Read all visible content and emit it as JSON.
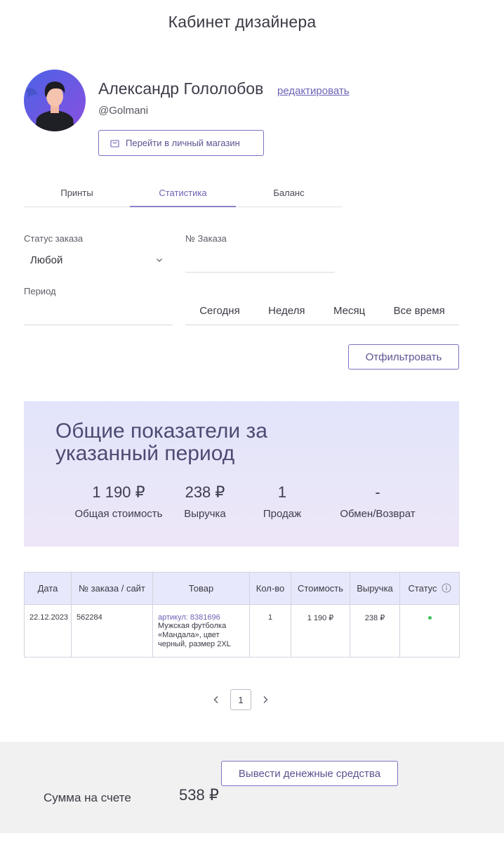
{
  "page": {
    "title": "Кабинет дизайнера"
  },
  "profile": {
    "name": "Александр Гололобов",
    "edit_label": "редактировать",
    "handle": "@Golmani",
    "shop_button_label": "Перейти в личный магазин"
  },
  "tabs": [
    {
      "label": "Принты",
      "active": false
    },
    {
      "label": "Статистика",
      "active": true
    },
    {
      "label": "Баланс",
      "active": false
    }
  ],
  "filters": {
    "status_label": "Статус заказа",
    "status_value": "Любой",
    "order_label": "№ Заказа",
    "order_value": "",
    "period_label": "Период",
    "period_value": "",
    "period_options": [
      "Сегодня",
      "Неделя",
      "Месяц",
      "Все время"
    ],
    "filter_button_label": "Отфильтровать"
  },
  "summary": {
    "title": "Общие показатели за указанный период",
    "stats": [
      {
        "value": "1 190 ₽",
        "label": "Общая стоимость"
      },
      {
        "value": "238 ₽",
        "label": "Выручка"
      },
      {
        "value": "1",
        "label": "Продаж"
      },
      {
        "value": "-",
        "label": "Обмен/Возврат"
      }
    ]
  },
  "table": {
    "headers": [
      "Дата",
      "№ заказа / сайт",
      "Товар",
      "Кол-во",
      "Стоимость",
      "Выручка",
      "Статус"
    ],
    "rows": [
      {
        "date": "22.12.2023",
        "order": "562284",
        "product_sku": "артикул: 8381696",
        "product_name": "Мужская футболка «Мандала», цвет черный, размер 2XL",
        "qty": "1",
        "cost": "1 190 ₽",
        "revenue": "238 ₽",
        "status_color": "#3fbf5f"
      }
    ]
  },
  "pagination": {
    "current": "1"
  },
  "footer": {
    "withdraw_label": "Вывести денежные средства",
    "balance_label": "Сумма на счете",
    "balance_value": "538 ₽"
  },
  "colors": {
    "accent": "#6b63b5",
    "panel": "#e2e5fa",
    "footer": "#f1f1f2"
  }
}
